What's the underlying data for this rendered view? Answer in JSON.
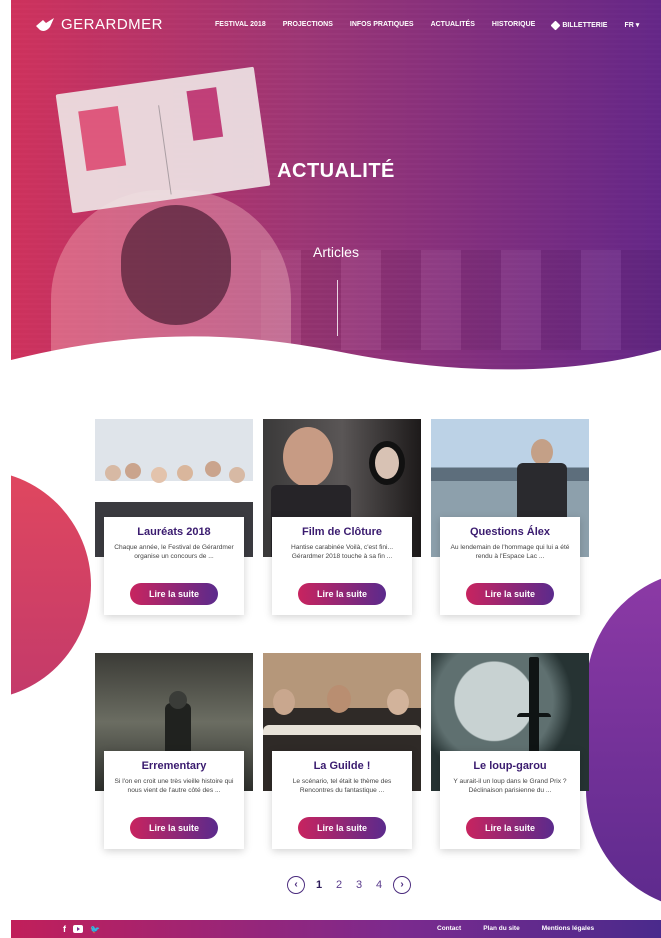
{
  "brand": {
    "name": "GERARDMER"
  },
  "nav": {
    "links": [
      "FESTIVAL 2018",
      "PROJECTIONS",
      "INFOS PRATIQUES",
      "ACTUALITÉS",
      "HISTORIQUE"
    ],
    "ticket": "BILLETTERIE",
    "lang": "FR ▾"
  },
  "hero": {
    "title": "ACTUALITÉ",
    "subtitle": "Articles"
  },
  "articles": [
    {
      "title": "Lauréats  2018",
      "excerpt": "Chaque année, le Festival de Gérardmer organise un concours de ...",
      "button": "Lire la suite"
    },
    {
      "title": "Film de Clôture",
      "excerpt": "Hantise carabinée Voilà, c'est fini... Gérardmer 2018 touche à sa fin ...",
      "button": "Lire la suite"
    },
    {
      "title": "Questions Álex",
      "excerpt": "Au lendemain de l'hommage qui lui a été rendu à l'Espace Lac ...",
      "button": "Lire la suite"
    },
    {
      "title": "Errementary",
      "excerpt": "Si l'on en croit une très vieille histoire qui nous vient de l'autre côté des ...",
      "button": "Lire la suite"
    },
    {
      "title": "La Guilde !",
      "excerpt": "Le scénario, tel était le thème des Rencontres du fantastique ...",
      "button": "Lire la suite"
    },
    {
      "title": "Le loup-garou",
      "excerpt": "Y aurait-il un loup dans le Grand Prix ? Déclinaison parisienne du ...",
      "button": "Lire la suite"
    }
  ],
  "pagination": {
    "prev": "‹",
    "pages": [
      "1",
      "2",
      "3",
      "4"
    ],
    "current": "1",
    "next": "›"
  },
  "footer": {
    "social": {
      "facebook": "f",
      "twitter": "🐦"
    },
    "links": [
      "Contact",
      "Plan du site",
      "Mentions légales"
    ]
  },
  "colors": {
    "accent_pink": "#c8245f",
    "accent_purple": "#5b2a8c",
    "title_purple": "#3a1b6f"
  }
}
